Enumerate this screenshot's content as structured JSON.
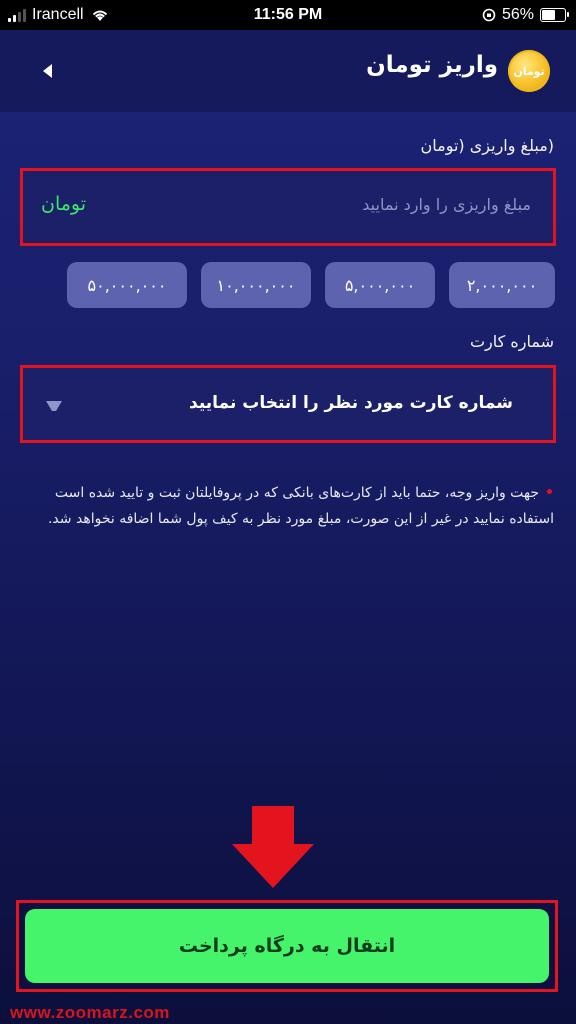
{
  "status_bar": {
    "carrier": "Irancell",
    "time": "11:56 PM",
    "battery": "56%"
  },
  "header": {
    "title": "واریز تومان",
    "coin_label": "تومان",
    "back_icon": "chevron-left-icon"
  },
  "amount": {
    "label": "(مبلغ واریزی (تومان",
    "placeholder": "مبلغ واریزی را وارد نمایید",
    "currency": "تومان"
  },
  "presets": [
    "۲,۰۰۰,۰۰۰",
    "۵,۰۰۰,۰۰۰",
    "۱۰,۰۰۰,۰۰۰",
    "۵۰,۰۰۰,۰۰۰"
  ],
  "card": {
    "label": "شماره کارت",
    "placeholder": "شماره کارت مورد نظر را انتخاب نمایید"
  },
  "note": {
    "bullet": "•",
    "text": "جهت واریز وجه، حتما باید از کارت‌های بانکی که در پروفایلتان ثبت و تایید شده است استفاده نمایید در غیر از این صورت، مبلغ مورد نظر به کیف پول شما اضافه نخواهد شد."
  },
  "submit": {
    "label": "انتقال به درگاه پرداخت"
  },
  "watermark": "www.zoomarz.com",
  "colors": {
    "accent_green": "#46f46b",
    "highlight_red": "#e4141f",
    "preset_bg": "#5d63ae",
    "header_bg": "#141a5c"
  }
}
